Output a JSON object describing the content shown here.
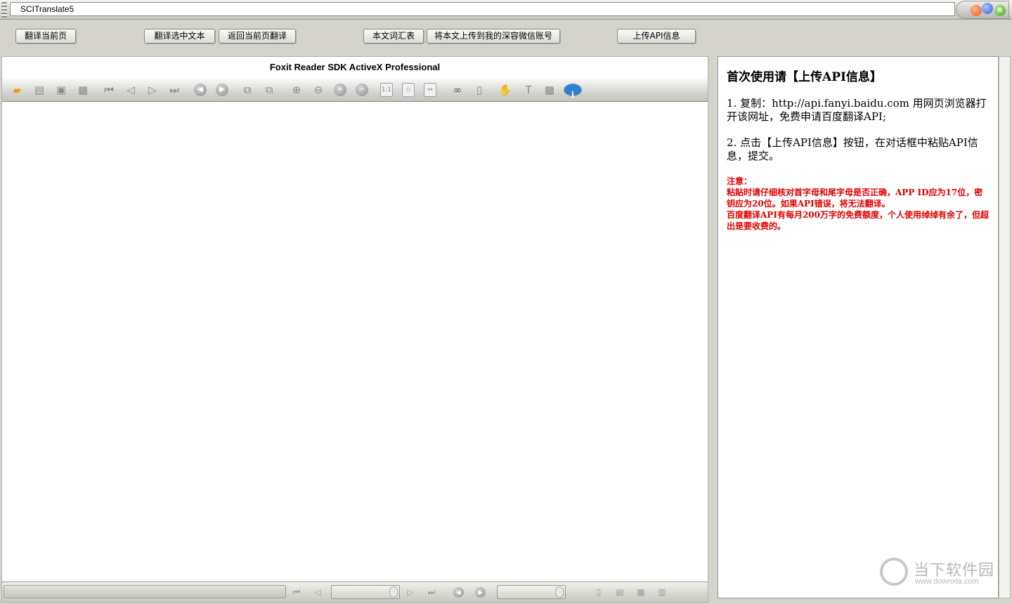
{
  "window": {
    "title": "SCITranslate5"
  },
  "actions": [
    {
      "label": "翻译当前页"
    },
    {
      "label": "翻译选中文本"
    },
    {
      "label": "返回当前页翻译"
    },
    {
      "label": "本文词汇表"
    },
    {
      "label": "将本文上传到我的深容微信账号"
    },
    {
      "label": "上传API信息"
    }
  ],
  "viewer": {
    "title": "Foxit Reader SDK ActiveX Professional",
    "toolbar_icons": [
      "open-folder-icon",
      "save-as-icon",
      "save-icon",
      "print-icon",
      "first-page-icon",
      "prev-page-icon",
      "next-page-icon",
      "last-page-icon",
      "back-icon",
      "forward-icon",
      "rotate-left-icon",
      "rotate-right-icon",
      "zoom-in-icon",
      "zoom-out-icon",
      "zoom-plus-icon",
      "zoom-minus-icon",
      "actual-size-icon",
      "fit-page-icon",
      "fit-width-icon",
      "find-icon",
      "bookmark-icon",
      "hand-tool-icon",
      "text-select-icon",
      "snapshot-icon",
      "info-icon"
    ],
    "status_icons": [
      "first-page-icon",
      "prev-page-icon",
      "next-page-icon",
      "last-page-icon",
      "back-icon",
      "forward-icon",
      "single-page-icon",
      "continuous-icon",
      "facing-icon",
      "two-page-icon"
    ]
  },
  "info": {
    "heading": "首次使用请【上传API信息】",
    "step1": "1. 复制：http://api.fanyi.baidu.com 用网页浏览器打开该网址，免费申请百度翻译API;",
    "step2": "2. 点击【上传API信息】按钮，在对话框中粘贴API信息，提交。",
    "note_title": "注意：",
    "note1": "粘贴时请仔细核对首字母和尾字母是否正确，APP ID应为17位，密钥应为20位。如果API错误，将无法翻译。",
    "note2": "百度翻译API有每月200万字的免费额度，个人使用绰绰有余了，但超出是要收费的。",
    "note_color": "#e00000"
  },
  "watermark": {
    "name": "当下软件园",
    "url": "www.downxia.com"
  }
}
